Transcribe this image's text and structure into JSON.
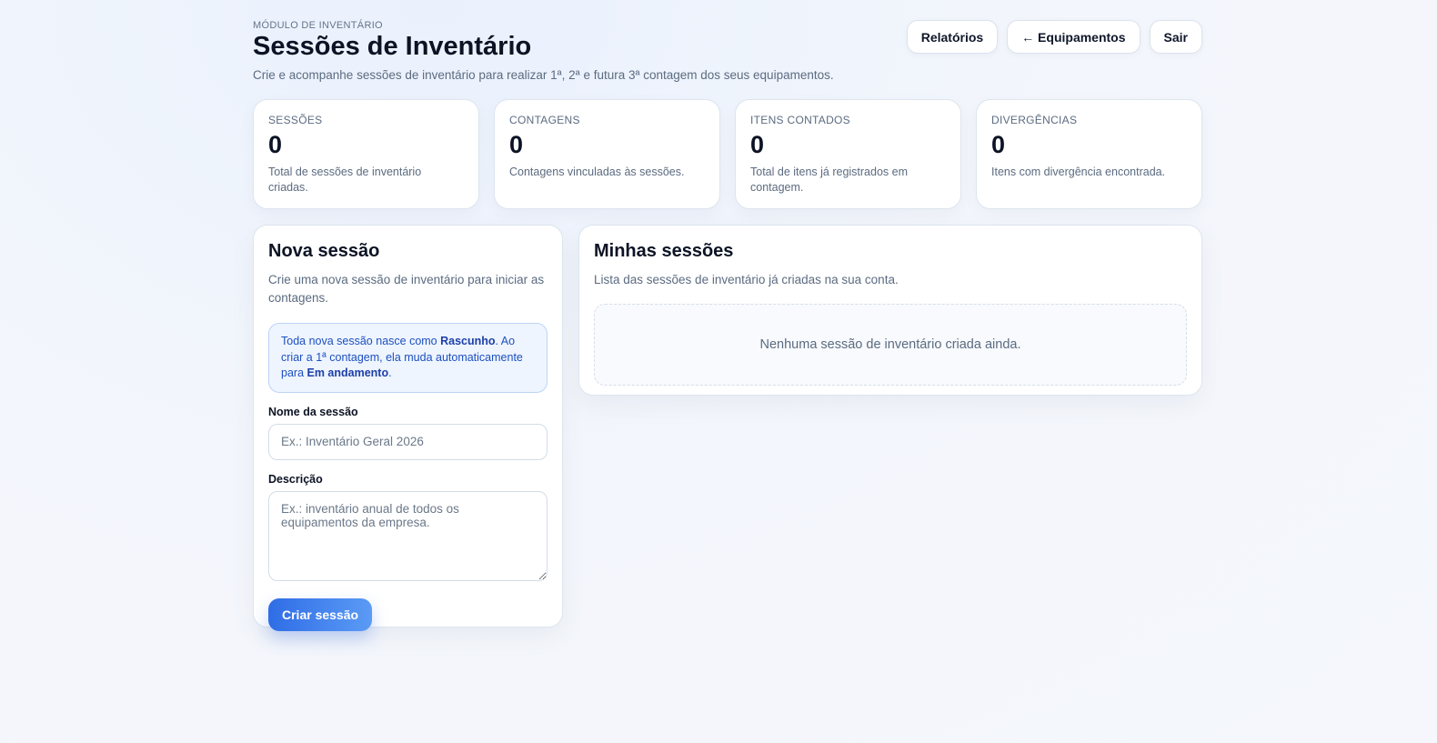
{
  "header": {
    "eyebrow": "MÓDULO DE INVENTÁRIO",
    "title": "Sessões de Inventário",
    "subtitle": "Crie e acompanhe sessões de inventário para realizar 1ª, 2ª e futura 3ª contagem dos seus equipamentos.",
    "actions": [
      {
        "label": "Relatórios"
      },
      {
        "label": "← Equipamentos"
      },
      {
        "label": "Sair"
      }
    ]
  },
  "stats": [
    {
      "label": "SESSÕES",
      "value": "0",
      "desc": "Total de sessões de inventário criadas."
    },
    {
      "label": "CONTAGENS",
      "value": "0",
      "desc": "Contagens vinculadas às sessões."
    },
    {
      "label": "ITENS CONTADOS",
      "value": "0",
      "desc": "Total de itens já registrados em contagem."
    },
    {
      "label": "DIVERGÊNCIAS",
      "value": "0",
      "desc": "Itens com divergência encontrada."
    }
  ],
  "new_session": {
    "title": "Nova sessão",
    "desc": "Crie uma nova sessão de inventário para iniciar as contagens.",
    "info": {
      "part1": "Toda nova sessão nasce como ",
      "bold1": "Rascunho",
      "part2": ". Ao criar a 1ª contagem, ela muda automaticamente para ",
      "bold2": "Em andamento",
      "part3": "."
    },
    "name_label": "Nome da sessão",
    "name_value": "",
    "name_placeholder": "Ex.: Inventário Geral 2026",
    "desc_label": "Descrição",
    "desc_value": "",
    "desc_placeholder": "Ex.: inventário anual de todos os equipamentos da empresa.",
    "submit_label": "Criar sessão"
  },
  "my_sessions": {
    "title": "Minhas sessões",
    "desc": "Lista das sessões de inventário já criadas na sua conta.",
    "empty_text": "Nenhuma sessão de inventário criada ainda."
  }
}
